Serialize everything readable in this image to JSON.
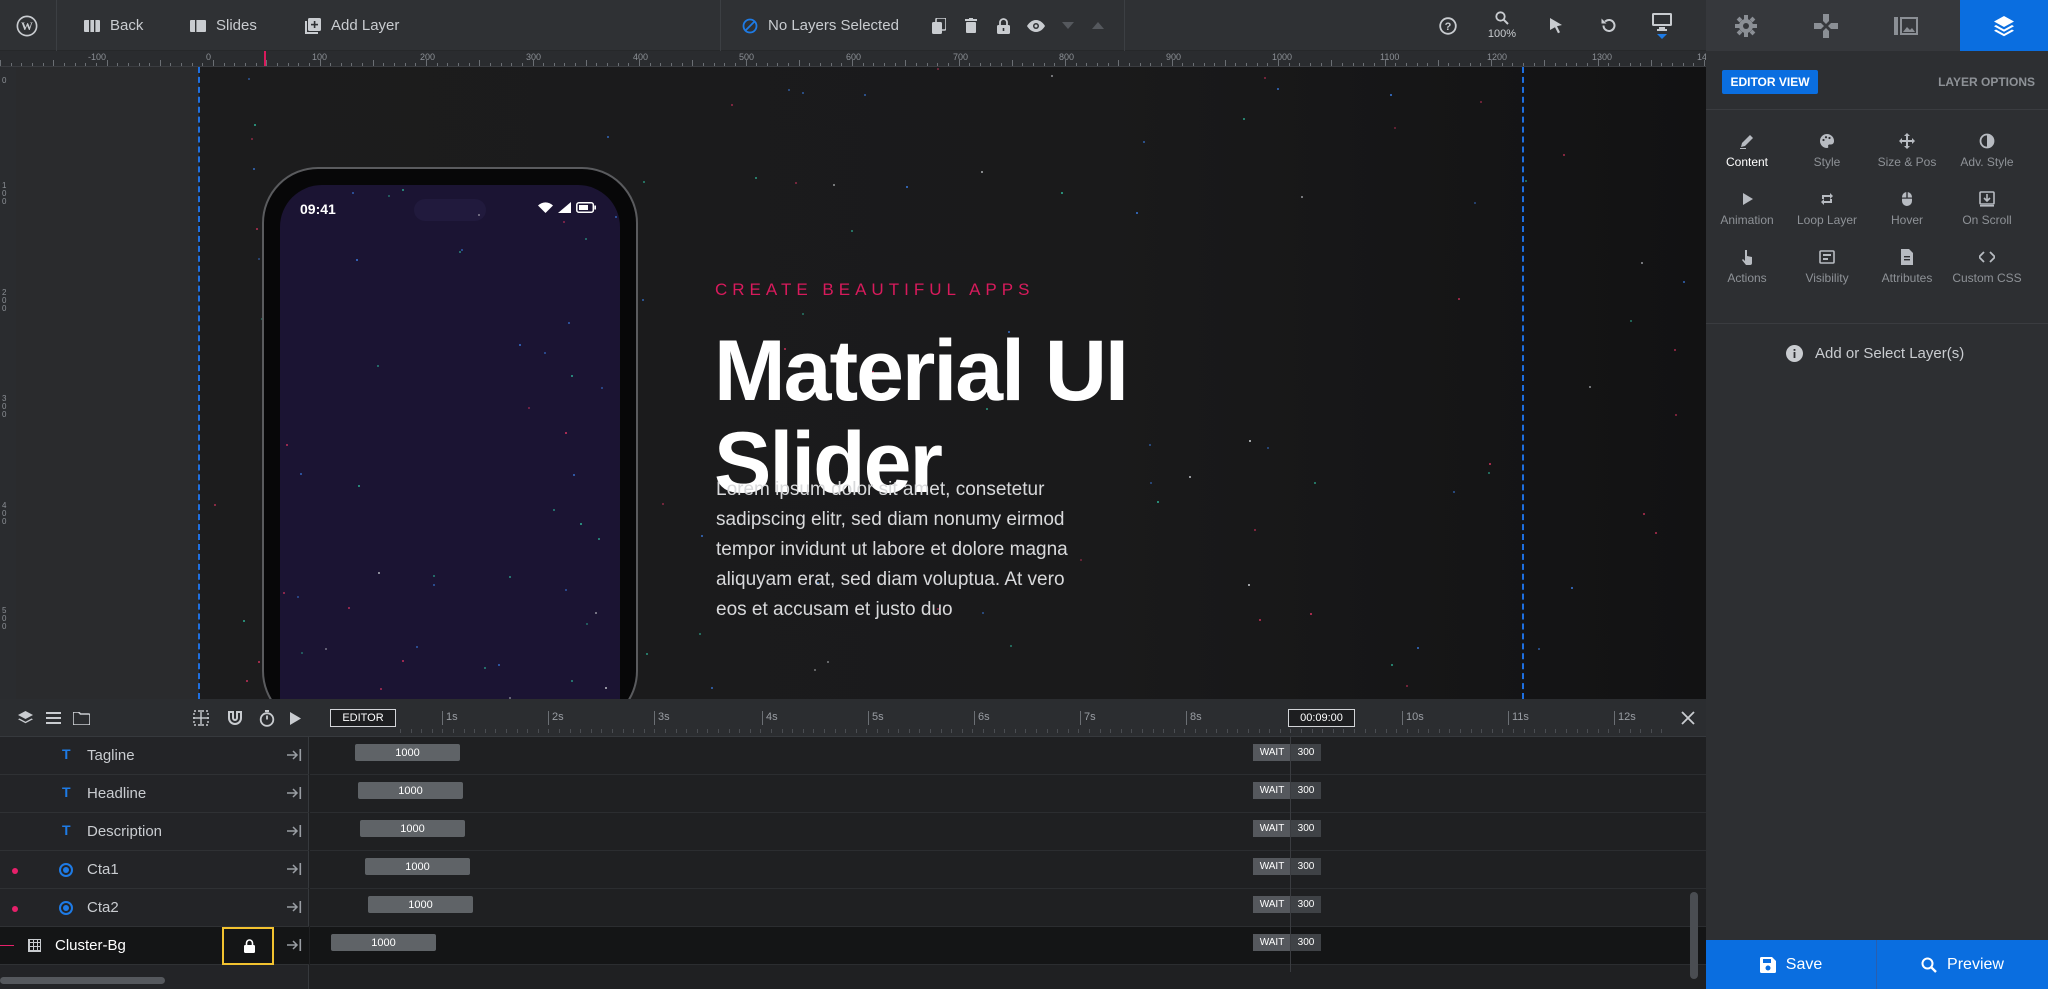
{
  "topbar": {
    "back_label": "Back",
    "slides_label": "Slides",
    "add_layer_label": "Add Layer",
    "selection_status": "No Layers Selected",
    "zoom_level": "100%"
  },
  "ruler": {
    "top_labels": [
      "-100",
      "0",
      "100",
      "200",
      "300",
      "400",
      "500",
      "600",
      "700",
      "800",
      "900",
      "1000",
      "1100",
      "1200",
      "1300",
      "14"
    ],
    "left_labels": [
      "0",
      "100",
      "200",
      "300",
      "400",
      "500"
    ]
  },
  "slide": {
    "phone_time": "09:41",
    "tagline": "CREATE BEAUTIFUL APPS",
    "headline_line1": "Material UI",
    "headline_line2": "Slider",
    "description": "Lorem ipsum dolor sit amet, consetetur sadipscing elitr, sed diam nonumy eirmod tempor invidunt ut labore et dolore magna aliquyam erat, sed diam voluptua. At vero eos et accusam et justo duo"
  },
  "timeline": {
    "editor_label": "EDITOR",
    "ticks": [
      "1s",
      "2s",
      "3s",
      "4s",
      "5s",
      "6s",
      "7s",
      "8s",
      "9s",
      "10s",
      "11s",
      "12s"
    ],
    "duration": "00:09:00",
    "layers": [
      {
        "name": "Tagline",
        "type": "text",
        "bar": "1000",
        "wait": "WAIT",
        "wait_value": "300"
      },
      {
        "name": "Headline",
        "type": "text",
        "bar": "1000",
        "wait": "WAIT",
        "wait_value": "300"
      },
      {
        "name": "Description",
        "type": "text",
        "bar": "1000",
        "wait": "WAIT",
        "wait_value": "300"
      },
      {
        "name": "Cta1",
        "type": "button",
        "bar": "1000",
        "wait": "WAIT",
        "wait_value": "300"
      },
      {
        "name": "Cta2",
        "type": "button",
        "bar": "1000",
        "wait": "WAIT",
        "wait_value": "300"
      },
      {
        "name": "Cluster-Bg",
        "type": "group",
        "bar": "1000",
        "wait": "WAIT",
        "wait_value": "300"
      }
    ]
  },
  "sidebar": {
    "editor_view_label": "EDITOR VIEW",
    "layer_options_label": "LAYER OPTIONS",
    "options": [
      {
        "label": "Content",
        "icon": "pencil-icon"
      },
      {
        "label": "Style",
        "icon": "palette-icon"
      },
      {
        "label": "Size & Pos",
        "icon": "move-icon"
      },
      {
        "label": "Adv. Style",
        "icon": "contrast-icon"
      },
      {
        "label": "Animation",
        "icon": "play-icon"
      },
      {
        "label": "Loop Layer",
        "icon": "loop-icon"
      },
      {
        "label": "Hover",
        "icon": "mouse-icon"
      },
      {
        "label": "On Scroll",
        "icon": "scroll-icon"
      },
      {
        "label": "Actions",
        "icon": "pointer-hand-icon"
      },
      {
        "label": "Visibility",
        "icon": "visibility-icon"
      },
      {
        "label": "Attributes",
        "icon": "document-icon"
      },
      {
        "label": "Custom CSS",
        "icon": "code-icon"
      }
    ],
    "empty_message": "Add or Select Layer(s)",
    "save_label": "Save",
    "preview_label": "Preview"
  },
  "colors": {
    "accent_blue": "#0a6ee0",
    "tagline_pink": "#d81a5c",
    "highlight_yellow": "#f2c230",
    "phone_screen": "#1b1433"
  }
}
